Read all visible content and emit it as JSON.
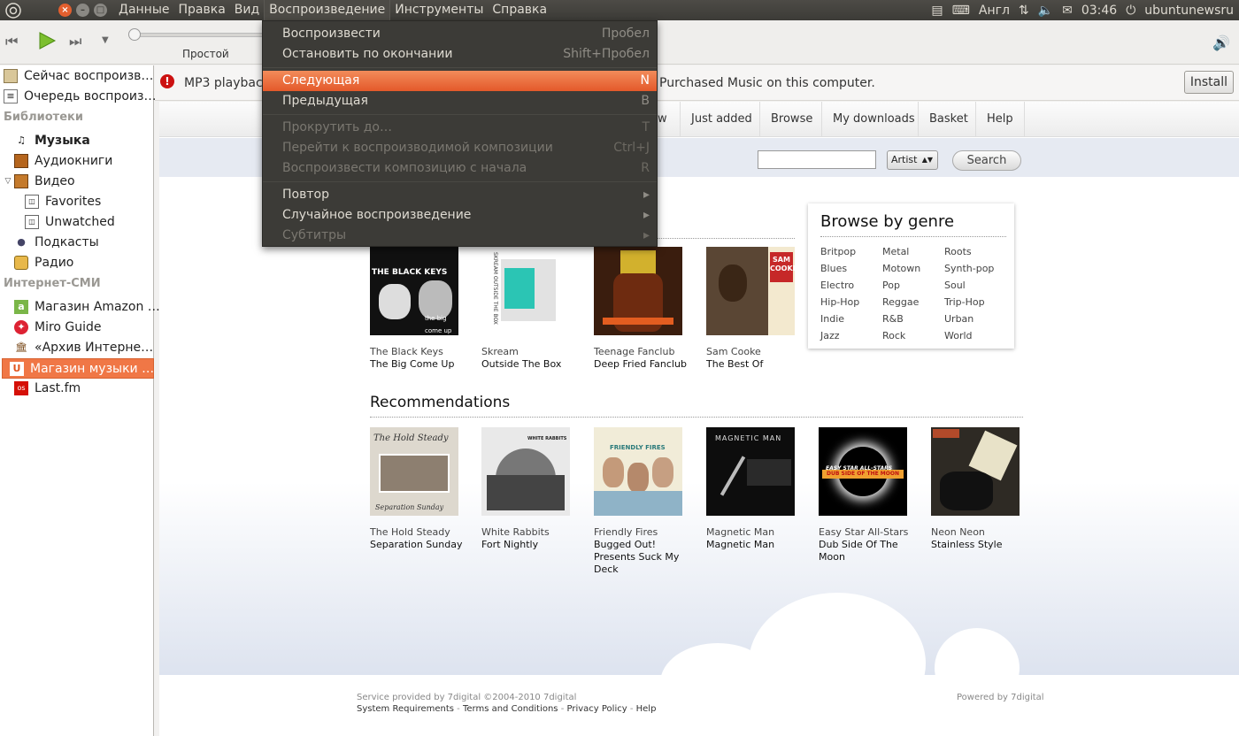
{
  "topbar": {
    "menu": [
      "Данные",
      "Правка",
      "Вид",
      "Воспроизведение",
      "Инструменты",
      "Справка"
    ],
    "keyboard_layout": "Англ",
    "time": "03:46",
    "username": "ubuntunewsru"
  },
  "toolbar": {
    "play_mode": "Простой"
  },
  "dropdown": {
    "items": [
      {
        "label": "Воспроизвести",
        "accel": "Пробел"
      },
      {
        "label": "Остановить по окончании",
        "accel": "Shift+Пробел"
      },
      {
        "label": "Следующая",
        "accel": "N"
      },
      {
        "label": "Предыдущая",
        "accel": "B"
      },
      {
        "label": "Прокрутить до…",
        "accel": "T"
      },
      {
        "label": "Перейти к воспроизводимой композиции",
        "accel": "Ctrl+J"
      },
      {
        "label": "Воспроизвести композицию с начала",
        "accel": "R"
      },
      {
        "label": "Повтор",
        "accel": "▸"
      },
      {
        "label": "Случайное воспроизведение",
        "accel": "▸"
      },
      {
        "label": "Субтитры",
        "accel": "▸"
      }
    ]
  },
  "sidebar": {
    "now_playing": "Сейчас воспроизв…",
    "queue": "Очередь воспроиз…",
    "libraries_header": "Библиотеки",
    "music": "Музыка",
    "audiobooks": "Аудиокниги",
    "video": "Видео",
    "favorites": "Favorites",
    "unwatched": "Unwatched",
    "podcasts": "Подкасты",
    "radio": "Радио",
    "internet_header": "Интернет-СМИ",
    "amazon": "Магазин Amazon …",
    "miro": "Miro Guide",
    "archive": "«Архив Интерне…",
    "music_store": "Магазин музыки …",
    "lastfm": "Last.fm"
  },
  "infobar": {
    "text_left": "MP3 playbac",
    "text_right": "Purchased Music on this computer.",
    "install": "Install"
  },
  "store": {
    "nav": [
      "ew",
      "Just added",
      "Browse",
      "My downloads",
      "Basket",
      "Help"
    ],
    "search_type": "Artist",
    "search_button": "Search",
    "albums": [
      {
        "artist": "The Black Keys",
        "title": "The Big Come Up"
      },
      {
        "artist": "Skream",
        "title": "Outside The Box"
      },
      {
        "artist": "Teenage Fanclub",
        "title": "Deep Fried Fanclub"
      },
      {
        "artist": "Sam Cooke",
        "title": "The Best Of"
      }
    ],
    "recommendations_title": "Recommendations",
    "recommendations": [
      {
        "artist": "The Hold Steady",
        "title": "Separation Sunday"
      },
      {
        "artist": "White Rabbits",
        "title": "Fort Nightly"
      },
      {
        "artist": "Friendly Fires",
        "title": "Bugged Out! Presents Suck My Deck"
      },
      {
        "artist": "Magnetic Man",
        "title": "Magnetic Man"
      },
      {
        "artist": "Easy Star All-Stars",
        "title": "Dub Side Of The Moon"
      },
      {
        "artist": "Neon Neon",
        "title": "Stainless Style"
      }
    ],
    "genre_title": "Browse by genre",
    "genres": [
      [
        "Britpop",
        "Metal",
        "Roots"
      ],
      [
        "Blues",
        "Motown",
        "Synth-pop"
      ],
      [
        "Electro",
        "Pop",
        "Soul"
      ],
      [
        "Hip-Hop",
        "Reggae",
        "Trip-Hop"
      ],
      [
        "Indie",
        "R&B",
        "Urban"
      ],
      [
        "Jazz",
        "Rock",
        "World"
      ]
    ],
    "cover_texts": {
      "black_keys_band": "THE BLACK KEYS",
      "black_keys_title": "the big come up",
      "skream_side": "SKREAM OUTSIDE THE BOX",
      "sam": "SAM",
      "cooke": "COOKE",
      "hold_steady": "The Hold Steady",
      "separation_sunday": "Separation Sunday",
      "white_rabbits": "WHITE RABBITS",
      "friendly_fires": "FRIENDLY FIRES",
      "magnetic_man": "MAGNETIC MAN",
      "easy_star": "EASY STAR ALL-STARS",
      "dub_side": "DUB SIDE OF THE MOON"
    },
    "footer": {
      "service": "Service provided by 7digital ©2004-2010 7digital",
      "links": [
        "System Requirements",
        "Terms and Conditions",
        "Privacy Policy",
        "Help"
      ],
      "powered": "Powered by 7digital"
    }
  }
}
